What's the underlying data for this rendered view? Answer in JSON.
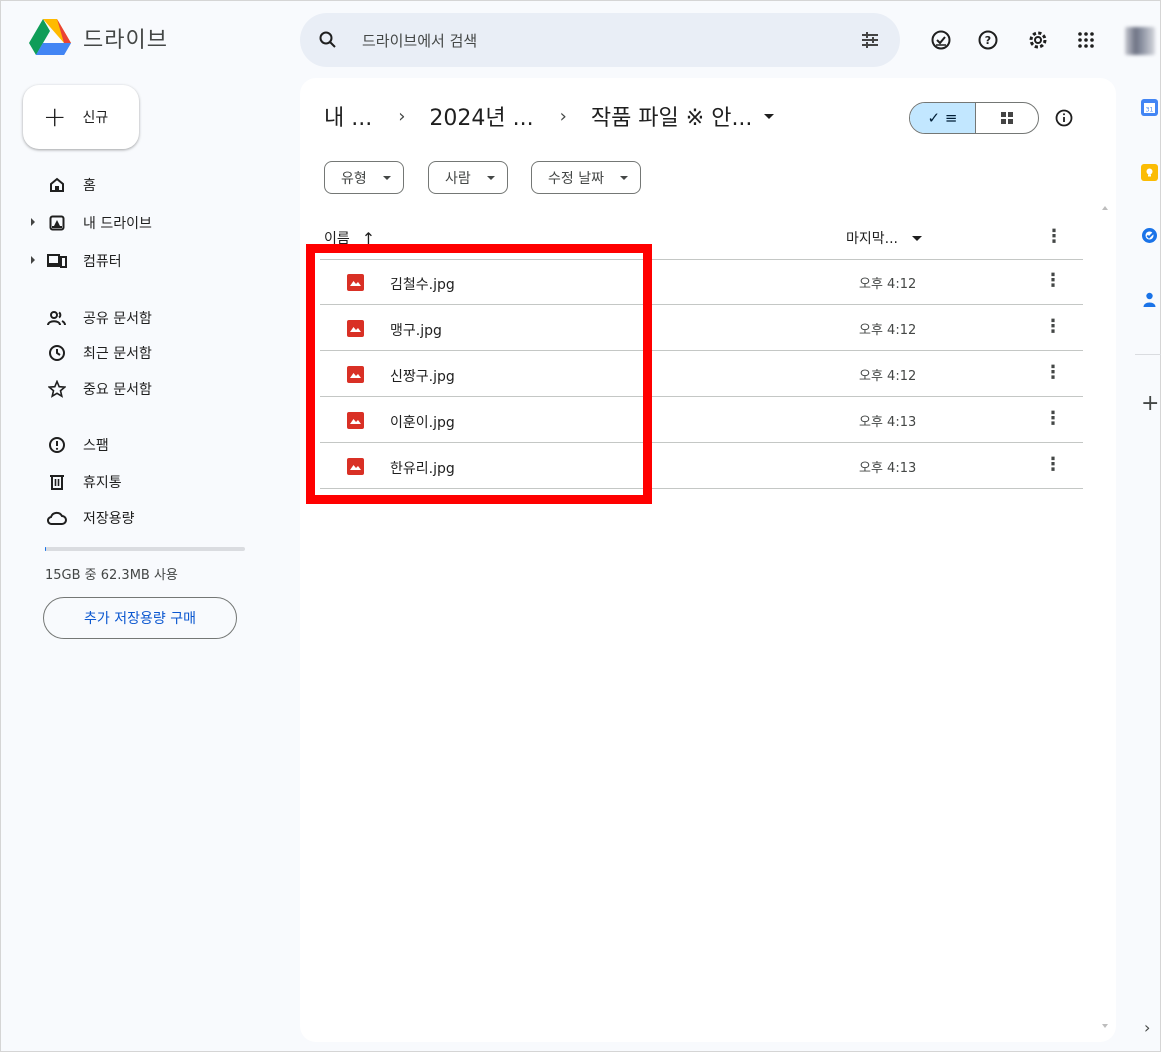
{
  "app": {
    "title": "드라이브"
  },
  "search": {
    "placeholder": "드라이브에서 검색"
  },
  "header_icons": [
    "search-options-icon",
    "offline-ready-icon",
    "help-icon",
    "settings-icon",
    "apps-grid-icon",
    "account-avatar"
  ],
  "sidebar": {
    "new_button": "신규",
    "items": [
      {
        "label": "홈",
        "icon": "home-icon"
      },
      {
        "label": "내 드라이브",
        "icon": "my-drive-icon"
      },
      {
        "label": "컴퓨터",
        "icon": "computer-icon"
      },
      {
        "label": "공유 문서함",
        "icon": "shared-icon"
      },
      {
        "label": "최근 문서함",
        "icon": "recent-icon"
      },
      {
        "label": "중요 문서함",
        "icon": "star-icon"
      },
      {
        "label": "스팸",
        "icon": "spam-icon"
      },
      {
        "label": "휴지통",
        "icon": "trash-icon"
      },
      {
        "label": "저장용량",
        "icon": "cloud-icon"
      }
    ],
    "storage_text": "15GB 중 62.3MB 사용",
    "storage_used_fraction": 0.004,
    "buy_button": "추가 저장용량 구매"
  },
  "breadcrumb": {
    "items": [
      "내 ...",
      "2024년 ...",
      "작품 파일 ※ 안..."
    ]
  },
  "view": {
    "list_label": "✓ ≡",
    "selected": "list"
  },
  "filters": [
    "유형",
    "사람",
    "수정 날짜"
  ],
  "table": {
    "col_name": "이름",
    "col_modified": "마지막...",
    "rows": [
      {
        "name": "김철수.jpg",
        "modified": "오후 4:12"
      },
      {
        "name": "맹구.jpg",
        "modified": "오후 4:12"
      },
      {
        "name": "신짱구.jpg",
        "modified": "오후 4:12"
      },
      {
        "name": "이훈이.jpg",
        "modified": "오후 4:13"
      },
      {
        "name": "한유리.jpg",
        "modified": "오후 4:13"
      }
    ]
  },
  "right_panel": [
    "calendar-icon",
    "keep-icon",
    "tasks-icon",
    "contacts-icon"
  ],
  "colors": {
    "accent": "#0b57d0",
    "highlight": "#ff0000",
    "image_icon": "#d93025",
    "selected_toggle": "#c2e7ff"
  }
}
